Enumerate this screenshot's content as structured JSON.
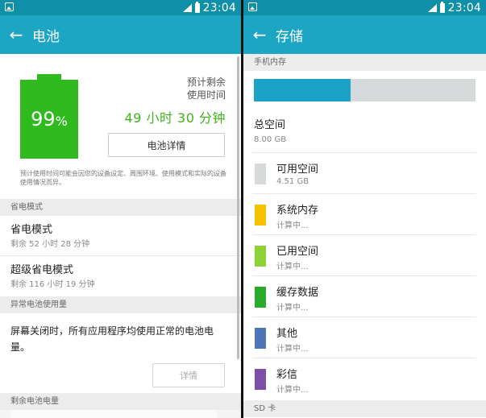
{
  "status_bar": {
    "time": "23:04"
  },
  "battery_screen": {
    "title": "电池",
    "battery_percent": "99",
    "percent_sign": "%",
    "battery_level": 0.99,
    "estimate_label": "预计剩余\n使用时间",
    "estimate_time": "49 小时 30 分钟",
    "detail_button": "电池详情",
    "note": "预计使用时间可能会因您的设备设定、周围环境、使用模式和实际的设备使用情况而异。",
    "power_saving_header": "省电模式",
    "modes": [
      {
        "title": "省电模式",
        "sub": "剩余 52 小时 28 分钟"
      },
      {
        "title": "超级省电模式",
        "sub": "剩余 116 小时 19 分钟"
      }
    ],
    "abnormal_header": "异常电池使用量",
    "abnormal_text": "屏幕关闭时，所有应用程序均使用正常的电池电量。",
    "abnormal_button": "详情",
    "remaining_header": "剩余电池电量"
  },
  "storage_screen": {
    "title": "存储",
    "phone_memory_header": "手机内存",
    "usage_fraction": 0.435,
    "total_label": "总空间",
    "total_value": "8.00 GB",
    "items": [
      {
        "title": "可用空间",
        "sub": "4.51 GB",
        "color": "#d7dadb"
      },
      {
        "title": "系统内存",
        "sub": "计算中...",
        "color": "#f6c200"
      },
      {
        "title": "已用空间",
        "sub": "计算中...",
        "color": "#8ed23a"
      },
      {
        "title": "缓存数据",
        "sub": "计算中...",
        "color": "#2bab2b"
      },
      {
        "title": "其他",
        "sub": "计算中...",
        "color": "#4f75b8"
      },
      {
        "title": "彩信",
        "sub": "计算中...",
        "color": "#7d4fa8"
      }
    ],
    "sd_header": "SD 卡"
  },
  "colors": {
    "status_bar": "#0f8fa8",
    "app_bar": "#1ca6c4",
    "battery_green": "#2fbb1f",
    "estimate_green": "#40b21c"
  }
}
